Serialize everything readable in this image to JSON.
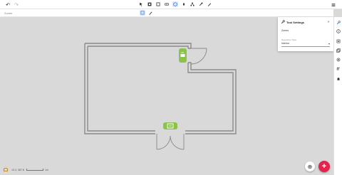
{
  "toolbar": {
    "undo_icon": "undo-icon",
    "redo_icon": "redo-icon",
    "tools": [
      "select-icon",
      "room-icon",
      "square-icon",
      "wall-icon",
      "cube-icon",
      "rotate-icon",
      "tree-icon",
      "shape-icon",
      "pen-icon"
    ],
    "menu_icon": "hamburger-icon"
  },
  "subbar": {
    "zones_label": "Zones"
  },
  "panel": {
    "title": "Tool Settings",
    "section": "Zones",
    "field_label": "New Zone Type",
    "field_value": "Interior"
  },
  "status": {
    "coords": "10.4, 387.8",
    "scale": "1m"
  },
  "colors": {
    "accent": "#2f6bd6",
    "fab": "#e4224c",
    "zone_green": "#8bc34a"
  }
}
